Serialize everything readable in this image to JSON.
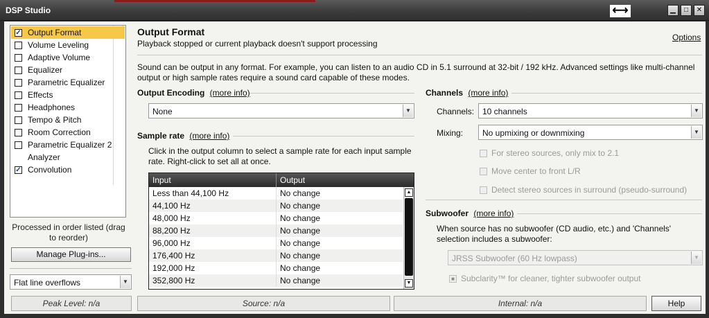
{
  "window": {
    "title": "DSP Studio",
    "resize_cursor": "⟷",
    "min_glyph": "▁",
    "max_glyph": "□",
    "close_glyph": "✕"
  },
  "plugins": [
    {
      "label": "Output Format",
      "checked": true,
      "selected": true
    },
    {
      "label": "Volume Leveling",
      "checked": false
    },
    {
      "label": "Adaptive Volume",
      "checked": false
    },
    {
      "label": "Equalizer",
      "checked": false
    },
    {
      "label": "Parametric Equalizer",
      "checked": false
    },
    {
      "label": "Effects",
      "checked": false
    },
    {
      "label": "Headphones",
      "checked": false
    },
    {
      "label": "Tempo & Pitch",
      "checked": false
    },
    {
      "label": "Room Correction",
      "checked": false
    },
    {
      "label": "Parametric Equalizer 2",
      "checked": false
    },
    {
      "label": "Analyzer",
      "checked": null
    },
    {
      "label": "Convolution",
      "checked": true
    }
  ],
  "left": {
    "order_note": "Processed in order listed (drag to reorder)",
    "manage_button": "Manage Plug-ins...",
    "overflow_select": "Flat line overflows"
  },
  "status": {
    "peak": "Peak Level: n/a",
    "source": "Source: n/a",
    "internal": "Internal: n/a",
    "help": "Help"
  },
  "main": {
    "title": "Output Format",
    "subtitle": "Playback stopped or current playback doesn't support processing",
    "options_link": "Options",
    "intro": "Sound can be output in any format.  For example, you can listen to an audio CD in 5.1 surround at 32-bit / 192 kHz.  Advanced settings like multi-channel output or high sample rates require a sound card capable of these modes.",
    "more_info": "(more info)",
    "encoding": {
      "header": "Output Encoding",
      "value": "None"
    },
    "sample_rate": {
      "header": "Sample rate",
      "help": "Click in the output column to select a sample rate for each input sample rate.  Right-click to set all at once.",
      "columns": [
        "Input",
        "Output"
      ],
      "rows": [
        [
          "Less than 44,100 Hz",
          "No change"
        ],
        [
          "44,100 Hz",
          "No change"
        ],
        [
          "48,000 Hz",
          "No change"
        ],
        [
          "88,200 Hz",
          "No change"
        ],
        [
          "96,000 Hz",
          "No change"
        ],
        [
          "176,400 Hz",
          "No change"
        ],
        [
          "192,000 Hz",
          "No change"
        ],
        [
          "352,800 Hz",
          "No change"
        ]
      ]
    },
    "channels": {
      "header": "Channels",
      "channels_label": "Channels:",
      "channels_value": "10 channels",
      "mixing_label": "Mixing:",
      "mixing_value": "No upmixing or downmixing",
      "opt_stereo_21": "For stereo sources, only mix to 2.1",
      "opt_move_center": "Move center to front L/R",
      "opt_detect_stereo": "Detect stereo sources in surround (pseudo-surround)"
    },
    "subwoofer": {
      "header": "Subwoofer",
      "desc": "When source has no subwoofer (CD audio, etc.) and 'Channels' selection includes a subwoofer:",
      "select_value": "JRSS Subwoofer (60 Hz lowpass)",
      "subclarity": "Subclarity™ for cleaner, tighter subwoofer output"
    }
  }
}
